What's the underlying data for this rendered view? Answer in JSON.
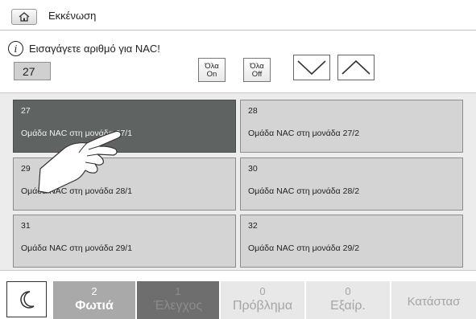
{
  "header": {
    "home_icon": "home-icon",
    "title": "Εκκένωση"
  },
  "prompt": {
    "info_icon_glyph": "i",
    "text": "Εισαγάγετε αριθμό για NAC!",
    "input_value": "27"
  },
  "controls": {
    "all_on": {
      "line1": "Όλα",
      "line2": "On"
    },
    "all_off": {
      "line1": "Όλα",
      "line2": "Off"
    },
    "down_icon": "chevron-down-icon",
    "up_icon": "chevron-up-icon"
  },
  "tiles": [
    {
      "number": "27",
      "label": "Ομάδα NAC στη μονάδα 27/1",
      "selected": true
    },
    {
      "number": "28",
      "label": "Ομάδα NAC στη μονάδα 27/2",
      "selected": false
    },
    {
      "number": "29",
      "label": "Ομάδα NAC στη μονάδα 28/1",
      "selected": false
    },
    {
      "number": "30",
      "label": "Ομάδα NAC στη μονάδα 28/2",
      "selected": false
    },
    {
      "number": "31",
      "label": "Ομάδα NAC στη μονάδα 29/1",
      "selected": false
    },
    {
      "number": "32",
      "label": "Ομάδα NAC στη μονάδα 29/2",
      "selected": false
    }
  ],
  "status_bar": {
    "mode_icon": "moon-icon",
    "fire": {
      "count": "2",
      "label": "Φωτιά"
    },
    "control": {
      "count": "1",
      "label": "Έλεγχος"
    },
    "trouble": {
      "count": "0",
      "label": "Πρόβλημα"
    },
    "exemption": {
      "count": "0",
      "label": "Εξαίρ."
    },
    "status": {
      "label": "Κατάστασ"
    }
  },
  "colors": {
    "selected_tile": "#5f6362",
    "tile": "#d4d4d4",
    "fire_segment": "#a9a9a9",
    "control_segment": "#6e6e6e",
    "inactive_segment": "#e8e8e8"
  }
}
